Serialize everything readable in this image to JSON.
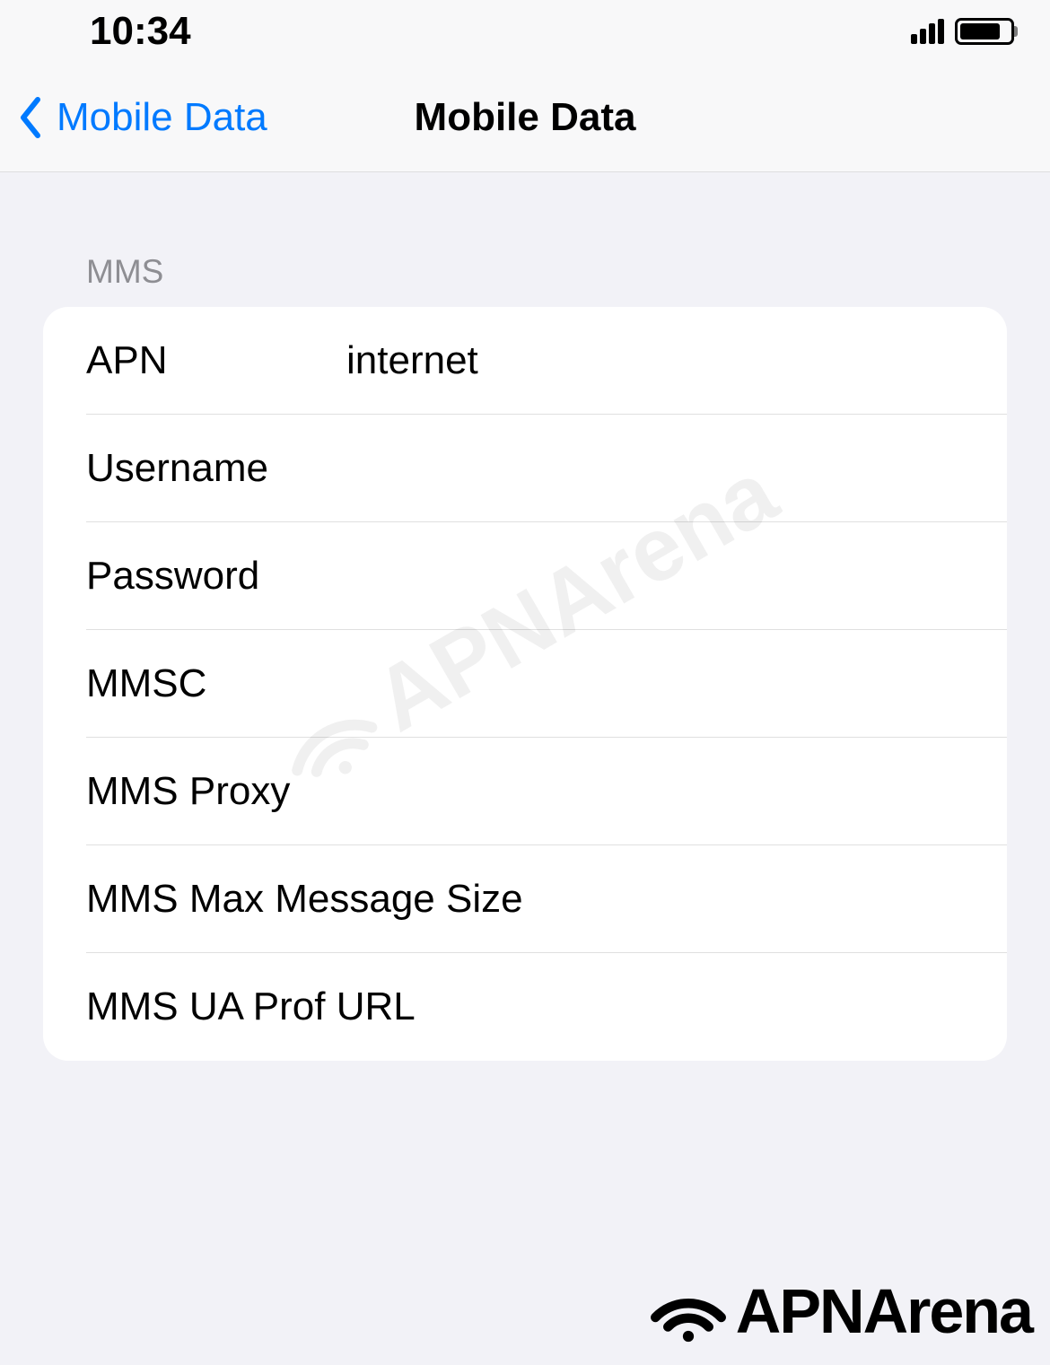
{
  "status_bar": {
    "time": "10:34"
  },
  "nav": {
    "back_label": "Mobile Data",
    "title": "Mobile Data"
  },
  "section": {
    "header": "MMS",
    "rows": [
      {
        "label": "APN",
        "value": "internet"
      },
      {
        "label": "Username",
        "value": ""
      },
      {
        "label": "Password",
        "value": ""
      },
      {
        "label": "MMSC",
        "value": ""
      },
      {
        "label": "MMS Proxy",
        "value": ""
      },
      {
        "label": "MMS Max Message Size",
        "value": ""
      },
      {
        "label": "MMS UA Prof URL",
        "value": ""
      }
    ]
  },
  "watermark": {
    "text": "APNArena"
  }
}
